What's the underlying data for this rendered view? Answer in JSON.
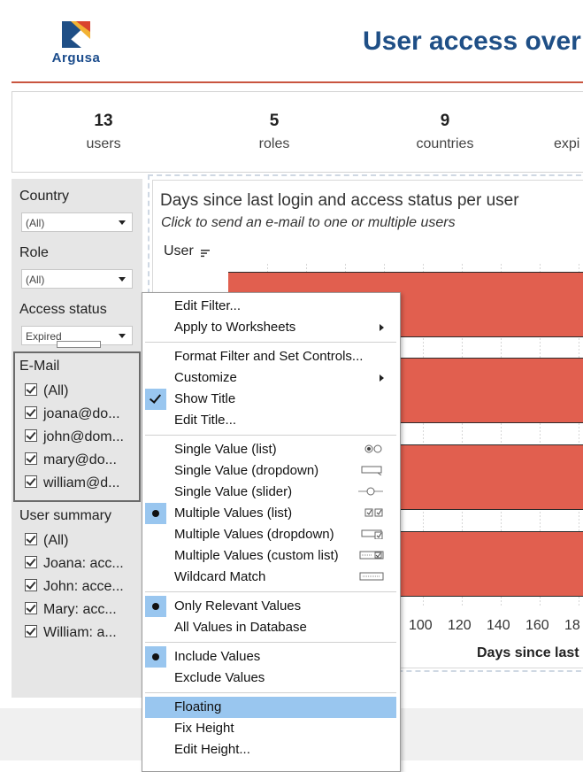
{
  "header": {
    "logo_text": "Argusa",
    "title": "User access over"
  },
  "kpis": [
    {
      "value": "13",
      "label": "users"
    },
    {
      "value": "5",
      "label": "roles"
    },
    {
      "value": "9",
      "label": "countries"
    },
    {
      "value": "",
      "label": "expi"
    }
  ],
  "filters": {
    "country": {
      "title": "Country",
      "value": "(All)"
    },
    "role": {
      "title": "Role",
      "value": "(All)"
    },
    "access_status": {
      "title": "Access status",
      "value": "Expired"
    },
    "email": {
      "title": "E-Mail",
      "items": [
        "(All)",
        "joana@do...",
        "john@dom...",
        "mary@do...",
        "william@d..."
      ]
    },
    "user_summary": {
      "title": "User summary",
      "items": [
        "(All)",
        "Joana: acc...",
        "John: acce...",
        "Mary: acc...",
        "William: a..."
      ]
    }
  },
  "worksheet": {
    "title": "Days since last login and access status per user",
    "subtitle": "Click to send an e-mail to one or multiple users",
    "column_header": "User",
    "x_ticks": [
      "100",
      "120",
      "140",
      "160",
      "18"
    ],
    "x_title": "Days since last",
    "bar_color": "#e15f4f"
  },
  "context_menu": {
    "items": [
      {
        "label": "Edit Filter...",
        "submenu": false
      },
      {
        "label": "Apply to Worksheets",
        "submenu": true
      },
      {
        "label": "Format Filter and Set Controls...",
        "submenu": false
      },
      {
        "label": "Customize",
        "submenu": true
      },
      {
        "label": "Show Title",
        "checked": true
      },
      {
        "label": "Edit Title..."
      },
      {
        "label": "Single Value (list)",
        "icon": "radio-list-icon"
      },
      {
        "label": "Single Value (dropdown)",
        "icon": "dropdown-icon"
      },
      {
        "label": "Single Value (slider)",
        "icon": "slider-icon"
      },
      {
        "label": "Multiple Values (list)",
        "selected": true,
        "icon": "checkbox-list-icon"
      },
      {
        "label": "Multiple Values (dropdown)",
        "icon": "dropdown-check-icon"
      },
      {
        "label": "Multiple Values (custom list)",
        "icon": "custom-list-icon"
      },
      {
        "label": "Wildcard Match",
        "icon": "wildcard-icon"
      },
      {
        "label": "Only Relevant Values",
        "selected": true
      },
      {
        "label": "All Values in Database"
      },
      {
        "label": "Include Values",
        "selected": true
      },
      {
        "label": "Exclude Values"
      },
      {
        "label": "Floating",
        "highlighted": true
      },
      {
        "label": "Fix Height"
      },
      {
        "label": "Edit Height..."
      }
    ],
    "highlight_color": "#99c6ef"
  }
}
